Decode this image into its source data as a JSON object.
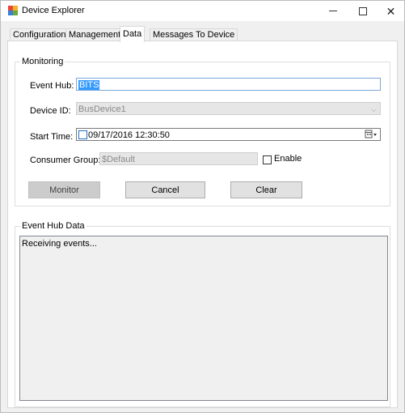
{
  "window": {
    "title": "Device Explorer",
    "controls": {
      "minimize": "—",
      "maximize": "□",
      "close": "✕"
    }
  },
  "tabs": [
    {
      "label": "Configuration",
      "active": false
    },
    {
      "label": "Management",
      "active": false
    },
    {
      "label": "Data",
      "active": true
    },
    {
      "label": "Messages To Device",
      "active": false
    }
  ],
  "monitoring": {
    "group_label": "Monitoring",
    "event_hub_label": "Event Hub:",
    "event_hub_value": "BITS",
    "device_id_label": "Device ID:",
    "device_id_value": "BusDevice1",
    "start_time_label": "Start Time:",
    "start_time_value": "09/17/2016 12:30:50",
    "consumer_group_label": "Consumer Group:",
    "consumer_group_value": "$Default",
    "enable_label": "Enable",
    "buttons": {
      "monitor": "Monitor",
      "cancel": "Cancel",
      "clear": "Clear"
    }
  },
  "event_hub_data": {
    "group_label": "Event Hub Data",
    "text": "Receiving events..."
  },
  "icons": {
    "app": "device-explorer-app-icon",
    "calendar": "calendar-dropdown-icon",
    "combo": "chevron-down-icon"
  }
}
